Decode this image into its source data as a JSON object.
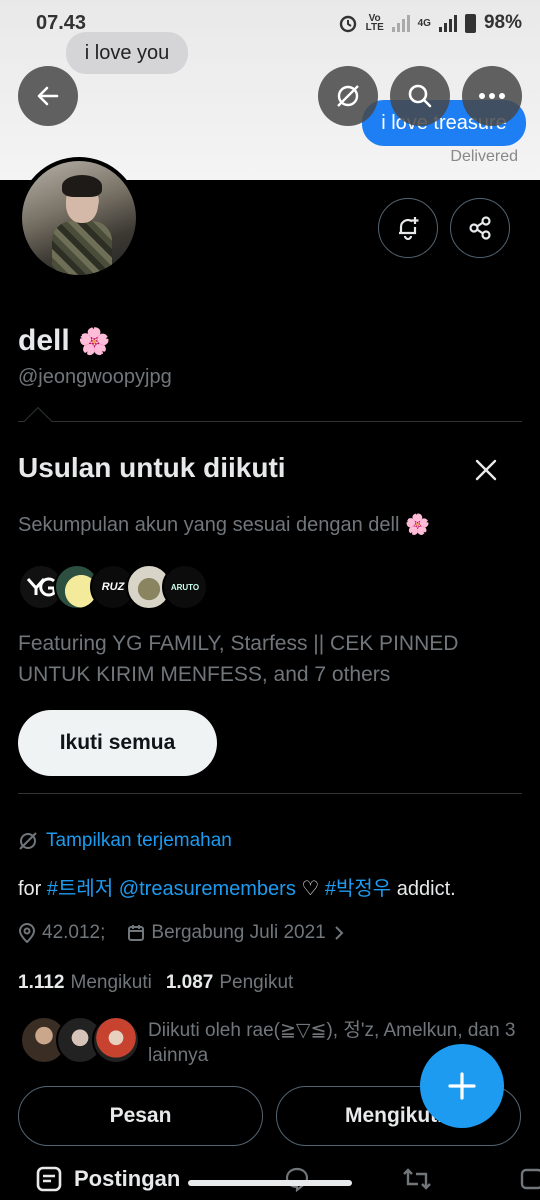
{
  "status_bar": {
    "time": "07.43",
    "net_volte": "Vo LTE",
    "net_4g": "4G",
    "battery": "98%"
  },
  "banner": {
    "bubble_received": "i love you",
    "bubble_sent": "i love treasure",
    "delivered": "Delivered"
  },
  "profile": {
    "name": "dell",
    "emoji": "🌸",
    "handle": "@jeongwoopyjpg"
  },
  "suggestions": {
    "title": "Usulan untuk diikuti",
    "subtitle": "Sekumpulan akun yang sesuai dengan dell 🌸",
    "accounts": [
      {
        "label": "YG",
        "color": "#111111"
      },
      {
        "label": "",
        "color": "#f0e7a3"
      },
      {
        "label": "RUZ",
        "color": "#0b0b0b"
      },
      {
        "label": "",
        "color": "#b6a98a"
      },
      {
        "label": "ARUTO",
        "color": "#0c0c0c"
      }
    ],
    "featuring": "Featuring YG FAMILY, Starfess || CEK PINNED UNTUK KIRIM MENFESS, and 7 others",
    "follow_all": "Ikuti semua"
  },
  "bio": {
    "translate": "Tampilkan terjemahan",
    "prefix": "for ",
    "tag1": "#트레저",
    "mention": "@treasuremembers",
    "heart": " ♡ ",
    "tag2": "#박정우",
    "suffix": " addict."
  },
  "meta": {
    "location": "42.012;",
    "joined": "Bergabung Juli 2021"
  },
  "stats": {
    "following_count": "1.112",
    "following_label": "Mengikuti",
    "followers_count": "1.087",
    "followers_label": "Pengikut"
  },
  "followed_by": "Diikuti oleh rae(≧▽≦), 정'z, Amelkun, dan 3 lainnya",
  "actions": {
    "message": "Pesan",
    "following": "Mengikuti"
  },
  "tabs": {
    "posts": "Postingan"
  },
  "colors": {
    "accent": "#1d9bf0",
    "background": "#000000",
    "muted": "#71767b"
  }
}
